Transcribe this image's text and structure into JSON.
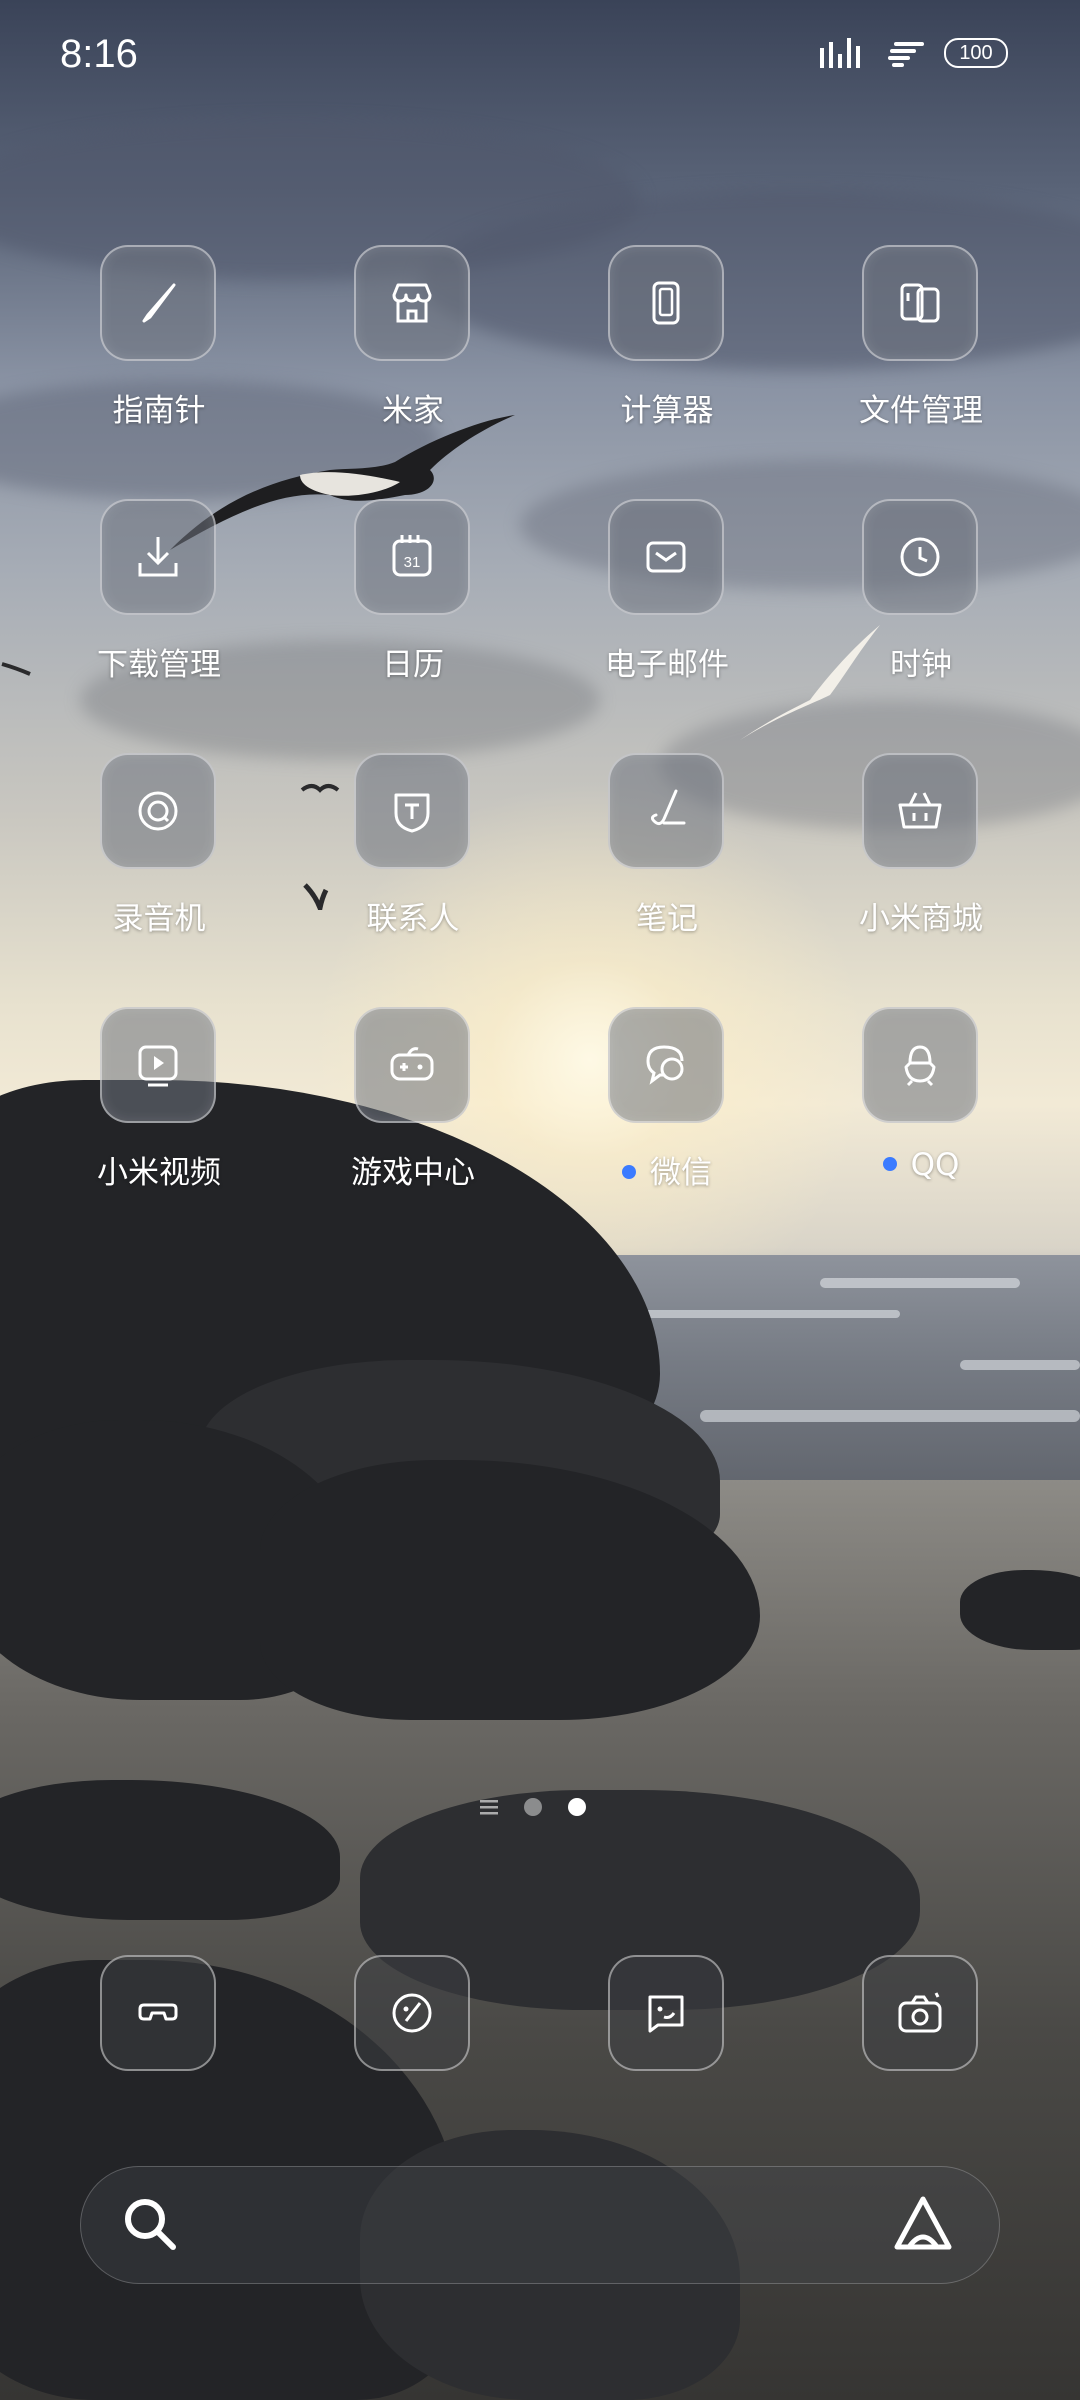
{
  "status_bar": {
    "time": "8:16",
    "battery": "100"
  },
  "apps": [
    {
      "label": "指南针",
      "icon": "compass-icon"
    },
    {
      "label": "米家",
      "icon": "home-store-icon"
    },
    {
      "label": "计算器",
      "icon": "calculator-icon"
    },
    {
      "label": "文件管理",
      "icon": "files-icon"
    },
    {
      "label": "下载管理",
      "icon": "download-icon"
    },
    {
      "label": "日历",
      "icon": "calendar-icon",
      "date": "31"
    },
    {
      "label": "电子邮件",
      "icon": "mail-icon"
    },
    {
      "label": "时钟",
      "icon": "clock-icon"
    },
    {
      "label": "录音机",
      "icon": "recorder-icon"
    },
    {
      "label": "联系人",
      "icon": "contacts-icon"
    },
    {
      "label": "笔记",
      "icon": "notes-icon"
    },
    {
      "label": "小米商城",
      "icon": "shop-basket-icon"
    },
    {
      "label": "小米视频",
      "icon": "video-icon"
    },
    {
      "label": "游戏中心",
      "icon": "gamepad-icon"
    },
    {
      "label": "微信",
      "icon": "wechat-icon",
      "new": true
    },
    {
      "label": "QQ",
      "icon": "qq-icon",
      "new": true
    }
  ],
  "dock": [
    {
      "icon": "phone-icon"
    },
    {
      "icon": "browser-icon"
    },
    {
      "icon": "messages-icon"
    },
    {
      "icon": "camera-icon"
    }
  ],
  "page_indicator": {
    "pages": 2,
    "active": 2
  },
  "colors": {
    "notification_dot": "#3b7bff",
    "text": "#ffffff"
  }
}
